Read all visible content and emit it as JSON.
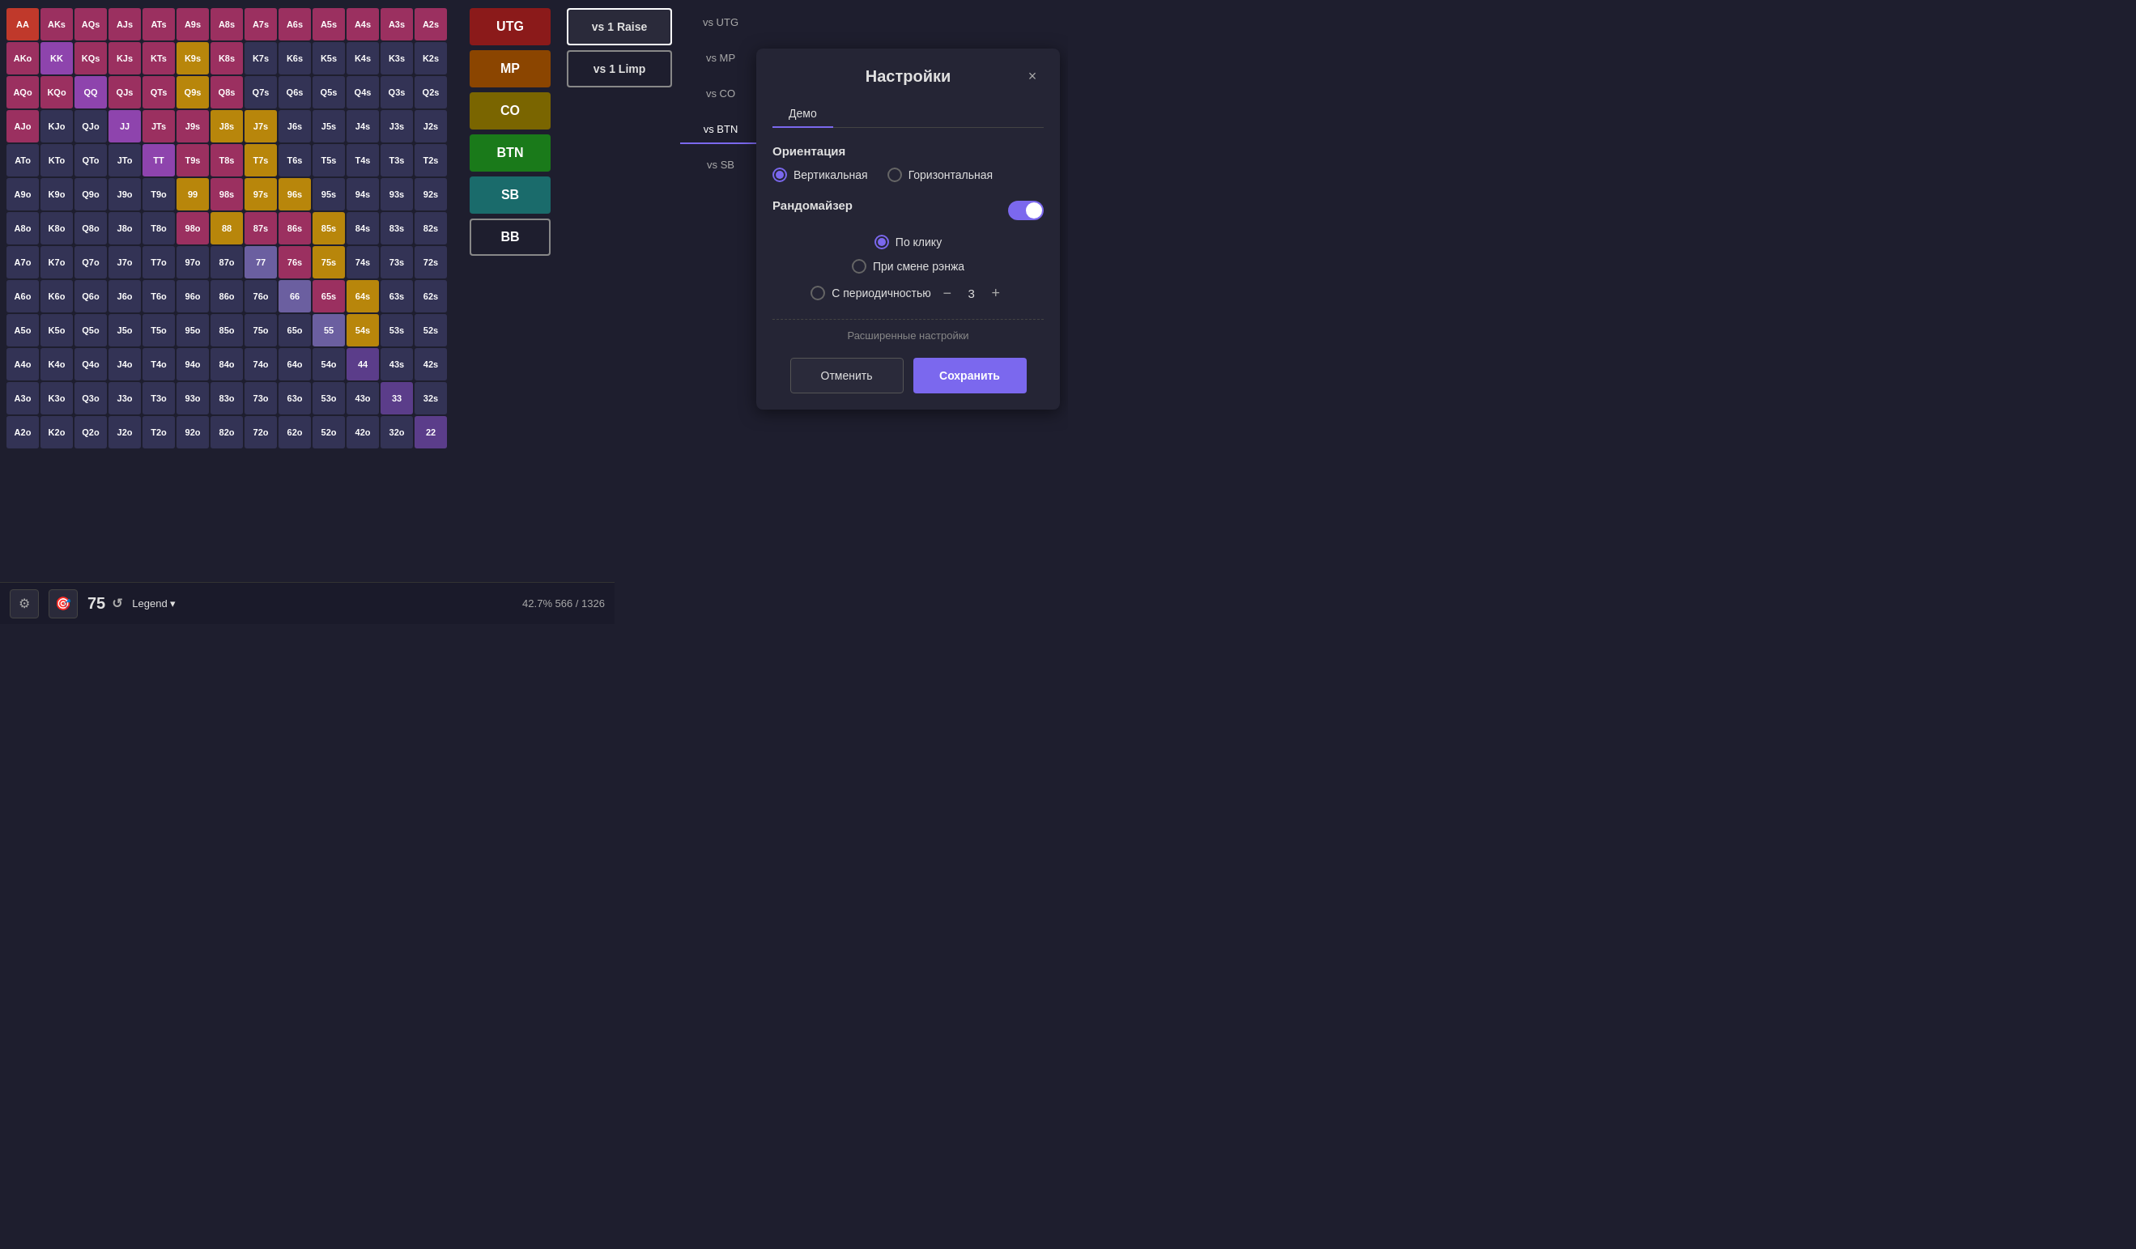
{
  "matrix": {
    "cells": [
      {
        "label": "AA",
        "cls": "c-AA"
      },
      {
        "label": "AKs",
        "cls": "c-AKs"
      },
      {
        "label": "AQs",
        "cls": "c-AQs"
      },
      {
        "label": "AJs",
        "cls": "c-AJs"
      },
      {
        "label": "ATs",
        "cls": "c-ATs"
      },
      {
        "label": "A9s",
        "cls": "c-A9s"
      },
      {
        "label": "A8s",
        "cls": "c-A8s"
      },
      {
        "label": "A7s",
        "cls": "c-A7s"
      },
      {
        "label": "A6s",
        "cls": "c-A6s"
      },
      {
        "label": "A5s",
        "cls": "c-A5s"
      },
      {
        "label": "A4s",
        "cls": "c-A4s"
      },
      {
        "label": "A3s",
        "cls": "c-A3s"
      },
      {
        "label": "A2s",
        "cls": "c-A2s"
      },
      {
        "label": "AKo",
        "cls": "c-AKo"
      },
      {
        "label": "KK",
        "cls": "c-KK"
      },
      {
        "label": "KQs",
        "cls": "c-KQs"
      },
      {
        "label": "KJs",
        "cls": "c-KJs"
      },
      {
        "label": "KTs",
        "cls": "c-KTs"
      },
      {
        "label": "K9s",
        "cls": "c-K9s"
      },
      {
        "label": "K8s",
        "cls": "c-K8s"
      },
      {
        "label": "K7s",
        "cls": "cell-offsuit"
      },
      {
        "label": "K6s",
        "cls": "cell-offsuit"
      },
      {
        "label": "K5s",
        "cls": "cell-offsuit"
      },
      {
        "label": "K4s",
        "cls": "cell-offsuit"
      },
      {
        "label": "K3s",
        "cls": "cell-offsuit"
      },
      {
        "label": "K2s",
        "cls": "cell-offsuit"
      },
      {
        "label": "AQo",
        "cls": "c-AQo"
      },
      {
        "label": "KQo",
        "cls": "c-KQo"
      },
      {
        "label": "QQ",
        "cls": "c-QQ"
      },
      {
        "label": "QJs",
        "cls": "c-QJs"
      },
      {
        "label": "QTs",
        "cls": "c-QTs"
      },
      {
        "label": "Q9s",
        "cls": "c-Q9s"
      },
      {
        "label": "Q8s",
        "cls": "c-Q8s"
      },
      {
        "label": "Q7s",
        "cls": "cell-offsuit"
      },
      {
        "label": "Q6s",
        "cls": "cell-offsuit"
      },
      {
        "label": "Q5s",
        "cls": "cell-offsuit"
      },
      {
        "label": "Q4s",
        "cls": "cell-offsuit"
      },
      {
        "label": "Q3s",
        "cls": "cell-offsuit"
      },
      {
        "label": "Q2s",
        "cls": "cell-offsuit"
      },
      {
        "label": "AJo",
        "cls": "c-AJo"
      },
      {
        "label": "KJo",
        "cls": "c-KJo"
      },
      {
        "label": "QJo",
        "cls": "c-QJo"
      },
      {
        "label": "JJ",
        "cls": "c-JJ"
      },
      {
        "label": "JTs",
        "cls": "c-JTs"
      },
      {
        "label": "J9s",
        "cls": "c-J9s"
      },
      {
        "label": "J8s",
        "cls": "c-J8s"
      },
      {
        "label": "J7s",
        "cls": "c-J7s"
      },
      {
        "label": "J6s",
        "cls": "cell-offsuit"
      },
      {
        "label": "J5s",
        "cls": "cell-offsuit"
      },
      {
        "label": "J4s",
        "cls": "cell-offsuit"
      },
      {
        "label": "J3s",
        "cls": "cell-offsuit"
      },
      {
        "label": "J2s",
        "cls": "cell-offsuit"
      },
      {
        "label": "ATo",
        "cls": "c-ATo"
      },
      {
        "label": "KTo",
        "cls": "cell-offsuit"
      },
      {
        "label": "QTo",
        "cls": "cell-offsuit"
      },
      {
        "label": "JTo",
        "cls": "cell-offsuit"
      },
      {
        "label": "TT",
        "cls": "c-TT"
      },
      {
        "label": "T9s",
        "cls": "c-T9s"
      },
      {
        "label": "T8s",
        "cls": "c-T8s"
      },
      {
        "label": "T7s",
        "cls": "c-T7s"
      },
      {
        "label": "T6s",
        "cls": "cell-offsuit"
      },
      {
        "label": "T5s",
        "cls": "cell-offsuit"
      },
      {
        "label": "T4s",
        "cls": "cell-offsuit"
      },
      {
        "label": "T3s",
        "cls": "cell-offsuit"
      },
      {
        "label": "T2s",
        "cls": "cell-offsuit"
      },
      {
        "label": "A9o",
        "cls": "cell-offsuit"
      },
      {
        "label": "K9o",
        "cls": "cell-offsuit"
      },
      {
        "label": "Q9o",
        "cls": "cell-offsuit"
      },
      {
        "label": "J9o",
        "cls": "cell-offsuit"
      },
      {
        "label": "T9o",
        "cls": "cell-offsuit"
      },
      {
        "label": "99",
        "cls": "c-99"
      },
      {
        "label": "98s",
        "cls": "c-98s"
      },
      {
        "label": "97s",
        "cls": "c-97s"
      },
      {
        "label": "96s",
        "cls": "c-96s"
      },
      {
        "label": "95s",
        "cls": "cell-offsuit"
      },
      {
        "label": "94s",
        "cls": "cell-offsuit"
      },
      {
        "label": "93s",
        "cls": "cell-offsuit"
      },
      {
        "label": "92s",
        "cls": "cell-offsuit"
      },
      {
        "label": "A8o",
        "cls": "cell-offsuit"
      },
      {
        "label": "K8o",
        "cls": "cell-offsuit"
      },
      {
        "label": "Q8o",
        "cls": "cell-offsuit"
      },
      {
        "label": "J8o",
        "cls": "cell-offsuit"
      },
      {
        "label": "T8o",
        "cls": "cell-offsuit"
      },
      {
        "label": "98o",
        "cls": "c-98s"
      },
      {
        "label": "88",
        "cls": "c-88"
      },
      {
        "label": "87s",
        "cls": "c-87s"
      },
      {
        "label": "86s",
        "cls": "c-86s"
      },
      {
        "label": "85s",
        "cls": "c-85s"
      },
      {
        "label": "84s",
        "cls": "cell-offsuit"
      },
      {
        "label": "83s",
        "cls": "cell-offsuit"
      },
      {
        "label": "82s",
        "cls": "cell-offsuit"
      },
      {
        "label": "A7o",
        "cls": "cell-offsuit"
      },
      {
        "label": "K7o",
        "cls": "cell-offsuit"
      },
      {
        "label": "Q7o",
        "cls": "cell-offsuit"
      },
      {
        "label": "J7o",
        "cls": "cell-offsuit"
      },
      {
        "label": "T7o",
        "cls": "cell-offsuit"
      },
      {
        "label": "97o",
        "cls": "cell-offsuit"
      },
      {
        "label": "87o",
        "cls": "cell-offsuit"
      },
      {
        "label": "77",
        "cls": "c-77"
      },
      {
        "label": "76s",
        "cls": "c-76s"
      },
      {
        "label": "75s",
        "cls": "c-75s"
      },
      {
        "label": "74s",
        "cls": "cell-offsuit"
      },
      {
        "label": "73s",
        "cls": "cell-offsuit"
      },
      {
        "label": "72s",
        "cls": "cell-offsuit"
      },
      {
        "label": "A6o",
        "cls": "cell-offsuit"
      },
      {
        "label": "K6o",
        "cls": "cell-offsuit"
      },
      {
        "label": "Q6o",
        "cls": "cell-offsuit"
      },
      {
        "label": "J6o",
        "cls": "cell-offsuit"
      },
      {
        "label": "T6o",
        "cls": "cell-offsuit"
      },
      {
        "label": "96o",
        "cls": "cell-offsuit"
      },
      {
        "label": "86o",
        "cls": "cell-offsuit"
      },
      {
        "label": "76o",
        "cls": "cell-offsuit"
      },
      {
        "label": "66",
        "cls": "c-66"
      },
      {
        "label": "65s",
        "cls": "c-65s"
      },
      {
        "label": "64s",
        "cls": "c-64s"
      },
      {
        "label": "63s",
        "cls": "cell-offsuit"
      },
      {
        "label": "62s",
        "cls": "cell-offsuit"
      },
      {
        "label": "A5o",
        "cls": "cell-offsuit"
      },
      {
        "label": "K5o",
        "cls": "cell-offsuit"
      },
      {
        "label": "Q5o",
        "cls": "cell-offsuit"
      },
      {
        "label": "J5o",
        "cls": "cell-offsuit"
      },
      {
        "label": "T5o",
        "cls": "cell-offsuit"
      },
      {
        "label": "95o",
        "cls": "cell-offsuit"
      },
      {
        "label": "85o",
        "cls": "cell-offsuit"
      },
      {
        "label": "75o",
        "cls": "cell-offsuit"
      },
      {
        "label": "65o",
        "cls": "cell-offsuit"
      },
      {
        "label": "55",
        "cls": "c-55"
      },
      {
        "label": "54s",
        "cls": "c-54s"
      },
      {
        "label": "53s",
        "cls": "cell-offsuit"
      },
      {
        "label": "52s",
        "cls": "cell-offsuit"
      },
      {
        "label": "A4o",
        "cls": "cell-offsuit"
      },
      {
        "label": "K4o",
        "cls": "cell-offsuit"
      },
      {
        "label": "Q4o",
        "cls": "cell-offsuit"
      },
      {
        "label": "J4o",
        "cls": "cell-offsuit"
      },
      {
        "label": "T4o",
        "cls": "cell-offsuit"
      },
      {
        "label": "94o",
        "cls": "cell-offsuit"
      },
      {
        "label": "84o",
        "cls": "cell-offsuit"
      },
      {
        "label": "74o",
        "cls": "cell-offsuit"
      },
      {
        "label": "64o",
        "cls": "cell-offsuit"
      },
      {
        "label": "54o",
        "cls": "cell-offsuit"
      },
      {
        "label": "44",
        "cls": "c-44"
      },
      {
        "label": "43s",
        "cls": "cell-offsuit"
      },
      {
        "label": "42s",
        "cls": "cell-offsuit"
      },
      {
        "label": "A3o",
        "cls": "cell-offsuit"
      },
      {
        "label": "K3o",
        "cls": "cell-offsuit"
      },
      {
        "label": "Q3o",
        "cls": "cell-offsuit"
      },
      {
        "label": "J3o",
        "cls": "cell-offsuit"
      },
      {
        "label": "T3o",
        "cls": "cell-offsuit"
      },
      {
        "label": "93o",
        "cls": "cell-offsuit"
      },
      {
        "label": "83o",
        "cls": "cell-offsuit"
      },
      {
        "label": "73o",
        "cls": "cell-offsuit"
      },
      {
        "label": "63o",
        "cls": "cell-offsuit"
      },
      {
        "label": "53o",
        "cls": "cell-offsuit"
      },
      {
        "label": "43o",
        "cls": "cell-offsuit"
      },
      {
        "label": "33",
        "cls": "c-33"
      },
      {
        "label": "32s",
        "cls": "cell-offsuit"
      },
      {
        "label": "A2o",
        "cls": "cell-offsuit"
      },
      {
        "label": "K2o",
        "cls": "cell-offsuit"
      },
      {
        "label": "Q2o",
        "cls": "cell-offsuit"
      },
      {
        "label": "J2o",
        "cls": "cell-offsuit"
      },
      {
        "label": "T2o",
        "cls": "cell-offsuit"
      },
      {
        "label": "92o",
        "cls": "cell-offsuit"
      },
      {
        "label": "82o",
        "cls": "cell-offsuit"
      },
      {
        "label": "72o",
        "cls": "cell-offsuit"
      },
      {
        "label": "62o",
        "cls": "cell-offsuit"
      },
      {
        "label": "52o",
        "cls": "cell-offsuit"
      },
      {
        "label": "42o",
        "cls": "cell-offsuit"
      },
      {
        "label": "32o",
        "cls": "cell-offsuit"
      },
      {
        "label": "22",
        "cls": "c-22"
      }
    ]
  },
  "positions": [
    {
      "label": "UTG",
      "cls": "pos-UTG",
      "key": "UTG"
    },
    {
      "label": "MP",
      "cls": "pos-MP",
      "key": "MP"
    },
    {
      "label": "CO",
      "cls": "pos-CO",
      "key": "CO"
    },
    {
      "label": "BTN",
      "cls": "pos-BTN",
      "key": "BTN"
    },
    {
      "label": "SB",
      "cls": "pos-SB",
      "key": "SB"
    },
    {
      "label": "BB",
      "cls": "pos-BB",
      "key": "BB"
    }
  ],
  "actions": [
    {
      "label": "vs 1 Raise",
      "active": true
    },
    {
      "label": "vs 1 Limp",
      "active": false
    }
  ],
  "vs_positions": [
    {
      "label": "vs UTG",
      "active": false
    },
    {
      "label": "vs MP",
      "active": false
    },
    {
      "label": "vs CO",
      "active": false
    },
    {
      "label": "vs BTN",
      "active": true
    },
    {
      "label": "vs SB",
      "active": false
    }
  ],
  "toolbar": {
    "number": "75",
    "legend": "Legend ▾",
    "stats": "42.7%   566 / 1326"
  },
  "settings": {
    "title": "Настройки",
    "close_label": "×",
    "tabs": [
      {
        "label": "Демо",
        "active": true
      }
    ],
    "orientation_title": "Ориентация",
    "orientation_options": [
      {
        "label": "Вертикальная",
        "checked": true
      },
      {
        "label": "Горизонтальная",
        "checked": false
      }
    ],
    "randomizer_title": "Рандомайзер",
    "randomizer_options": [
      {
        "label": "По клику",
        "checked": true
      },
      {
        "label": "При смене рэнжа",
        "checked": false
      },
      {
        "label": "С периодичностью",
        "checked": false
      }
    ],
    "stepper_value": "3",
    "advanced_label": "Расширенные настройки",
    "cancel_label": "Отменить",
    "save_label": "Сохранить"
  }
}
